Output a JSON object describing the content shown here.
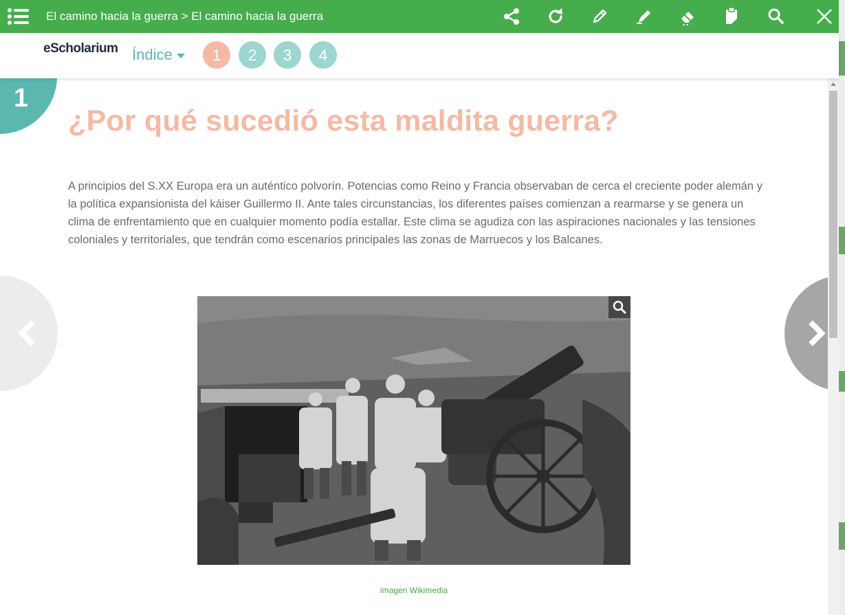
{
  "header": {
    "breadcrumb": "El camino hacia la guerra > El camino hacia la guerra",
    "tools": [
      "share-icon",
      "refresh-icon",
      "pencil-icon",
      "marker-icon",
      "eraser-icon",
      "clipboard-icon",
      "search-icon",
      "close-icon"
    ]
  },
  "nav": {
    "logo": "eScholarium",
    "index_label": "Índice",
    "pages": [
      "1",
      "2",
      "3",
      "4"
    ],
    "active_page": "1"
  },
  "content": {
    "section_number": "1",
    "heading": "¿Por qué sucedió esta maldita guerra?",
    "paragraph": "A principios del S.XX Europa era un auténtico polvorín. Potencias como Reino y Francia observaban de cerca el creciente  poder alemán y la política expansionista del káiser Guillermo II. Ante tales circunstancias, los diferentes países comienzan a rearmarse y se genera un clima de enfrentamiento que en cualquier momento podía estallar. Este clima se agudiza con las aspiraciones nacionales y las tensiones coloniales y territoriales, que tendrán como escenarios principales las zonas de Marruecos y los Balcanes.",
    "image_caption": "imagen Wikimedia"
  },
  "colors": {
    "header_green": "#46ad4d",
    "accent_teal": "#5ab8b1",
    "accent_salmon": "#f5b9a4"
  }
}
